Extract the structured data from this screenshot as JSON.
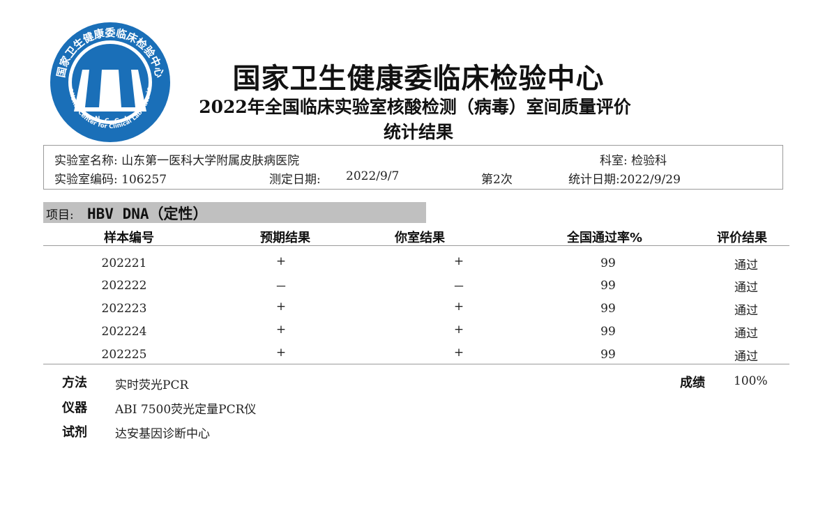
{
  "logo": {
    "ring_text": "国家卫生健康委临床检验中心",
    "ring_text_en": "National Center for Clinical Laboratories",
    "abbr_letters": [
      "N",
      "C",
      "C",
      "L"
    ],
    "color": "#1a6fb8"
  },
  "header": {
    "title": "国家卫生健康委临床检验中心",
    "subtitle": "2022年全国临床实验室核酸检测（病毒）室间质量评价",
    "subtitle2": "统计结果"
  },
  "info": {
    "lab_name_label": "实验室名称:",
    "lab_name": "山东第一医科大学附属皮肤病医院",
    "dept_label": "科室:",
    "dept": "检验科",
    "lab_code_label": "实验室编码:",
    "lab_code": "106257",
    "test_date_label": "测定日期:",
    "test_date": "2022/9/7",
    "round": "第2次",
    "stat_date_label": "统计日期:",
    "stat_date": "2022/9/29"
  },
  "project": {
    "label": "项目:",
    "value": "HBV DNA（定性）"
  },
  "table": {
    "headers": [
      "样本编号",
      "预期结果",
      "你室结果",
      "全国通过率%",
      "评价结果"
    ],
    "rows": [
      [
        "202221",
        "+",
        "+",
        "99",
        "通过"
      ],
      [
        "202222",
        "－",
        "－",
        "99",
        "通过"
      ],
      [
        "202223",
        "+",
        "+",
        "99",
        "通过"
      ],
      [
        "202224",
        "+",
        "+",
        "99",
        "通过"
      ],
      [
        "202225",
        "+",
        "+",
        "99",
        "通过"
      ]
    ]
  },
  "footer": {
    "method_label": "方法",
    "method": "实时荧光PCR",
    "instrument_label": "仪器",
    "instrument": "ABI 7500荧光定量PCR仪",
    "reagent_label": "试剂",
    "reagent": "达安基因诊断中心",
    "score_label": "成绩",
    "score": "100%"
  }
}
